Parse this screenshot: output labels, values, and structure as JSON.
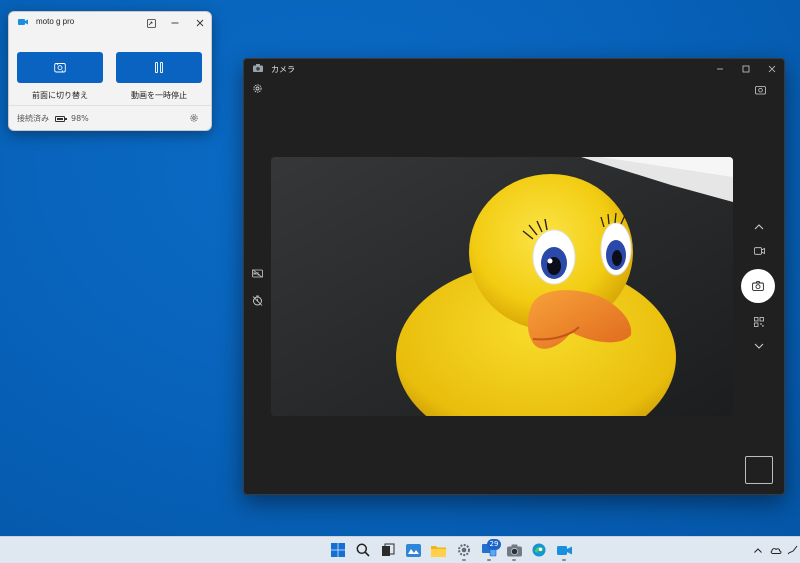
{
  "phone_link": {
    "title": "moto g pro",
    "switch_label": "前面に切り替え",
    "pause_label": "動画を一時停止",
    "status": "接続済み",
    "battery": "98%",
    "battery_level": 0.98
  },
  "camera": {
    "title": "カメラ"
  },
  "taskbar": {
    "badge_count": "29"
  },
  "colors": {
    "accent": "#0a63c1",
    "desktop": "#0760b6",
    "camera_bg": "#202020",
    "duck_yellow": "#f5d214",
    "duck_beak": "#f08a28"
  }
}
